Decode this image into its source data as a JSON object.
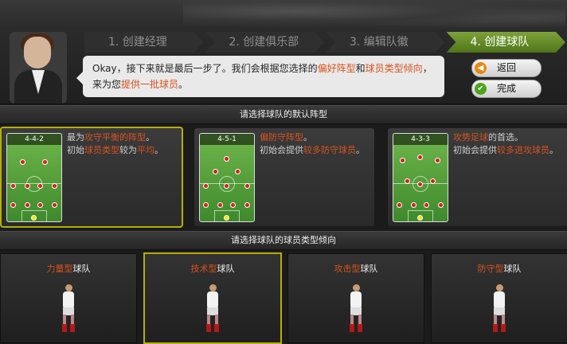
{
  "steps": [
    {
      "label": "1. 创建经理"
    },
    {
      "label": "2. 创建俱乐部"
    },
    {
      "label": "3. 编辑队徽"
    },
    {
      "label": "4. 创建球队"
    }
  ],
  "manager_message": {
    "part1": "Okay，接下来就是最后一步了。我们会根据您选择的",
    "hl1": "偏好阵型",
    "part2": "和",
    "hl2": "球员类型倾向",
    "part3": "，来为您",
    "hl3": "提供一批球员",
    "part4": "。"
  },
  "buttons": {
    "back": "返回",
    "done": "完成"
  },
  "formation_section": {
    "title": "请选择球队的默认阵型"
  },
  "formations": [
    {
      "name": "4-4-2",
      "line1_a": "最为",
      "line1_hl": "攻守平衡的阵型",
      "line1_b": "。",
      "line2_a": "初始",
      "line2_hl1": "球员类型",
      "line2_b": "较为",
      "line2_hl2": "平均",
      "line2_c": "。",
      "selected": true
    },
    {
      "name": "4-5-1",
      "line1_a": "",
      "line1_hl": "偏防守阵型",
      "line1_b": "。",
      "line2_a": "初始会提供",
      "line2_hl1": "较多防守球员",
      "line2_b": "。",
      "line2_hl2": "",
      "line2_c": "",
      "selected": false
    },
    {
      "name": "4-3-3",
      "line1_a": "",
      "line1_hl": "攻势足球",
      "line1_b": "的首选。",
      "line2_a": "初始会提供",
      "line2_hl1": "较多进攻球员",
      "line2_b": "。",
      "line2_hl2": "",
      "line2_c": "",
      "selected": false
    }
  ],
  "type_section": {
    "title": "请选择球队的球员类型倾向"
  },
  "team_types": [
    {
      "hl": "力量型",
      "suffix": "球队",
      "selected": false
    },
    {
      "hl": "技术型",
      "suffix": "球队",
      "selected": true
    },
    {
      "hl": "攻击型",
      "suffix": "球队",
      "selected": false
    },
    {
      "hl": "防守型",
      "suffix": "球队",
      "selected": false
    }
  ],
  "colors": {
    "highlight": "#d8521e",
    "active_step": "#6a9128",
    "selection_border": "#b6b000"
  }
}
